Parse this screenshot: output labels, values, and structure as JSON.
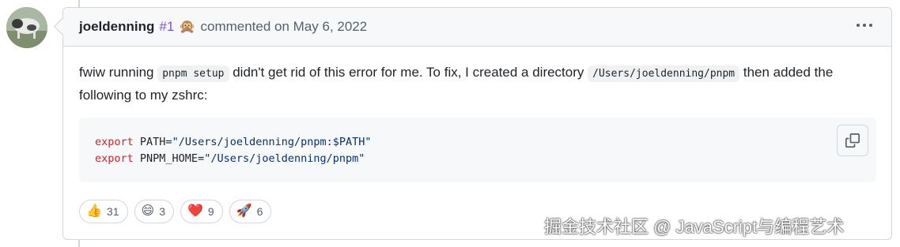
{
  "comment": {
    "author": "joeldenning",
    "issue_ref": "#1",
    "author_emoji": "🙊",
    "meta": "commented on May 6, 2022",
    "body": {
      "text_1": "fwiw running ",
      "code_1": "pnpm setup",
      "text_2": " didn't get rid of this error for me. To fix, I created a directory ",
      "code_2": "/Users/joeldenning/pnpm",
      "text_3": " then added the following to my zshrc:"
    },
    "code_block": {
      "line1_kw": "export",
      "line1_rest": " PATH=",
      "line1_str": "\"/Users/joeldenning/pnpm:$PATH\"",
      "line2_kw": "export",
      "line2_rest": " PNPM_HOME=",
      "line2_str": "\"/Users/joeldenning/pnpm\""
    },
    "reactions": [
      {
        "emoji": "👍",
        "count": "31"
      },
      {
        "emoji": "😄",
        "count": "3"
      },
      {
        "emoji": "❤️",
        "count": "9"
      },
      {
        "emoji": "🚀",
        "count": "6"
      }
    ]
  },
  "watermark": "掘金技术社区 @ JavaScript与编程艺术",
  "icons": {
    "more": "kebab-horizontal-icon",
    "copy": "copy-icon"
  }
}
